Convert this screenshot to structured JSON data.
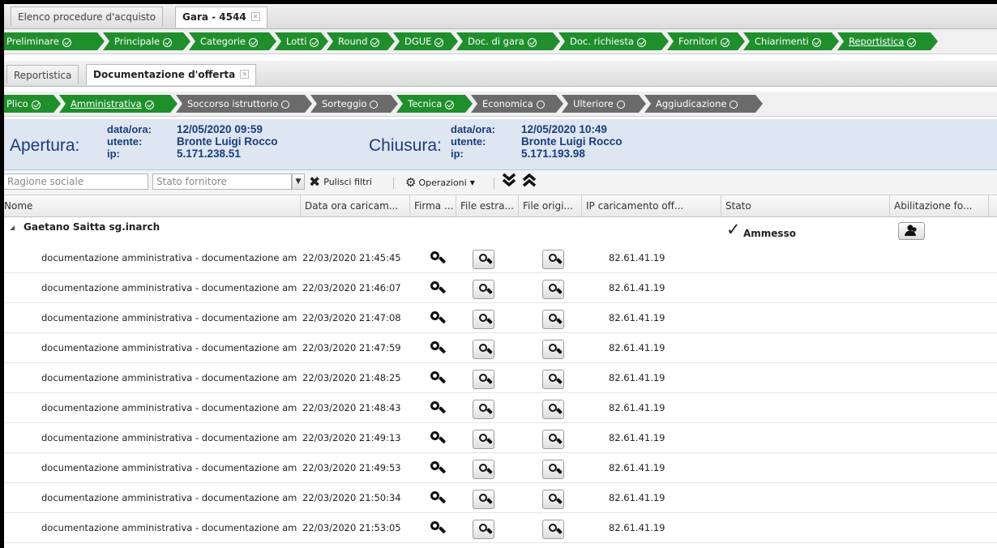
{
  "top_tabs": [
    {
      "label": "Elenco procedure d'acquisto"
    },
    {
      "label": "Gara - 4544"
    }
  ],
  "main_steps": [
    {
      "label": "Preliminare"
    },
    {
      "label": "Principale"
    },
    {
      "label": "Categorie"
    },
    {
      "label": "Lotti"
    },
    {
      "label": "Round"
    },
    {
      "label": "DGUE"
    },
    {
      "label": "Doc. di gara"
    },
    {
      "label": "Doc. richiesta"
    },
    {
      "label": "Fornitori"
    },
    {
      "label": "Chiarimenti"
    },
    {
      "label": "Reportistica"
    }
  ],
  "sub_tabs": [
    {
      "label": "Reportistica"
    },
    {
      "label": "Documentazione d'offerta"
    }
  ],
  "sub_steps": [
    {
      "label": "Plico"
    },
    {
      "label": "Amministrativa"
    },
    {
      "label": "Soccorso istruttorio"
    },
    {
      "label": "Sorteggio"
    },
    {
      "label": "Tecnica"
    },
    {
      "label": "Economica"
    },
    {
      "label": "Ulteriore"
    },
    {
      "label": "Aggiudicazione"
    }
  ],
  "info": {
    "apertura": {
      "title": "Apertura:",
      "dataora_label": "data/ora:",
      "utente_label": "utente:",
      "ip_label": "ip:",
      "dataora": "12/05/2020 09:59",
      "utente": "Bronte Luigi Rocco",
      "ip": "5.171.238.51"
    },
    "chiusura": {
      "title": "Chiusura:",
      "dataora_label": "data/ora:",
      "utente_label": "utente:",
      "ip_label": "ip:",
      "dataora": "12/05/2020 10:49",
      "utente": "Bronte Luigi Rocco",
      "ip": "5.171.193.98"
    }
  },
  "toolbar": {
    "ragione_placeholder": "Ragione sociale",
    "stato_placeholder": "Stato fornitore",
    "pulisci_label": "Pulisci filtri",
    "operazioni_label": "Operazioni"
  },
  "columns": [
    "Nome",
    "Data ora caricam...",
    "Firma ...",
    "File estra...",
    "File origi...",
    "IP caricamento off...",
    "Stato",
    "Abilitazione fo..."
  ],
  "group": {
    "name": "Gaetano Saitta sg.inarch",
    "stato": "Ammesso"
  },
  "rows": [
    {
      "nome": "documentazione amministrativa - documentazione am",
      "data": "22/03/2020 21:45:45",
      "ip": "82.61.41.19"
    },
    {
      "nome": "documentazione amministrativa - documentazione am",
      "data": "22/03/2020 21:46:07",
      "ip": "82.61.41.19"
    },
    {
      "nome": "documentazione amministrativa - documentazione am",
      "data": "22/03/2020 21:47:08",
      "ip": "82.61.41.19"
    },
    {
      "nome": "documentazione amministrativa - documentazione am",
      "data": "22/03/2020 21:47:59",
      "ip": "82.61.41.19"
    },
    {
      "nome": "documentazione amministrativa - documentazione am",
      "data": "22/03/2020 21:48:25",
      "ip": "82.61.41.19"
    },
    {
      "nome": "documentazione amministrativa - documentazione am",
      "data": "22/03/2020 21:48:43",
      "ip": "82.61.41.19"
    },
    {
      "nome": "documentazione amministrativa - documentazione am",
      "data": "22/03/2020 21:49:13",
      "ip": "82.61.41.19"
    },
    {
      "nome": "documentazione amministrativa - documentazione am",
      "data": "22/03/2020 21:49:53",
      "ip": "82.61.41.19"
    },
    {
      "nome": "documentazione amministrativa - documentazione am",
      "data": "22/03/2020 21:50:34",
      "ip": "82.61.41.19"
    },
    {
      "nome": "documentazione amministrativa - documentazione am",
      "data": "22/03/2020 21:53:05",
      "ip": "82.61.41.19"
    }
  ],
  "colors": {
    "step_green": "#1f8f2c",
    "step_gray": "#6b6b6b",
    "info_text": "#1a3c7c",
    "info_bg": "#dde6f1"
  }
}
